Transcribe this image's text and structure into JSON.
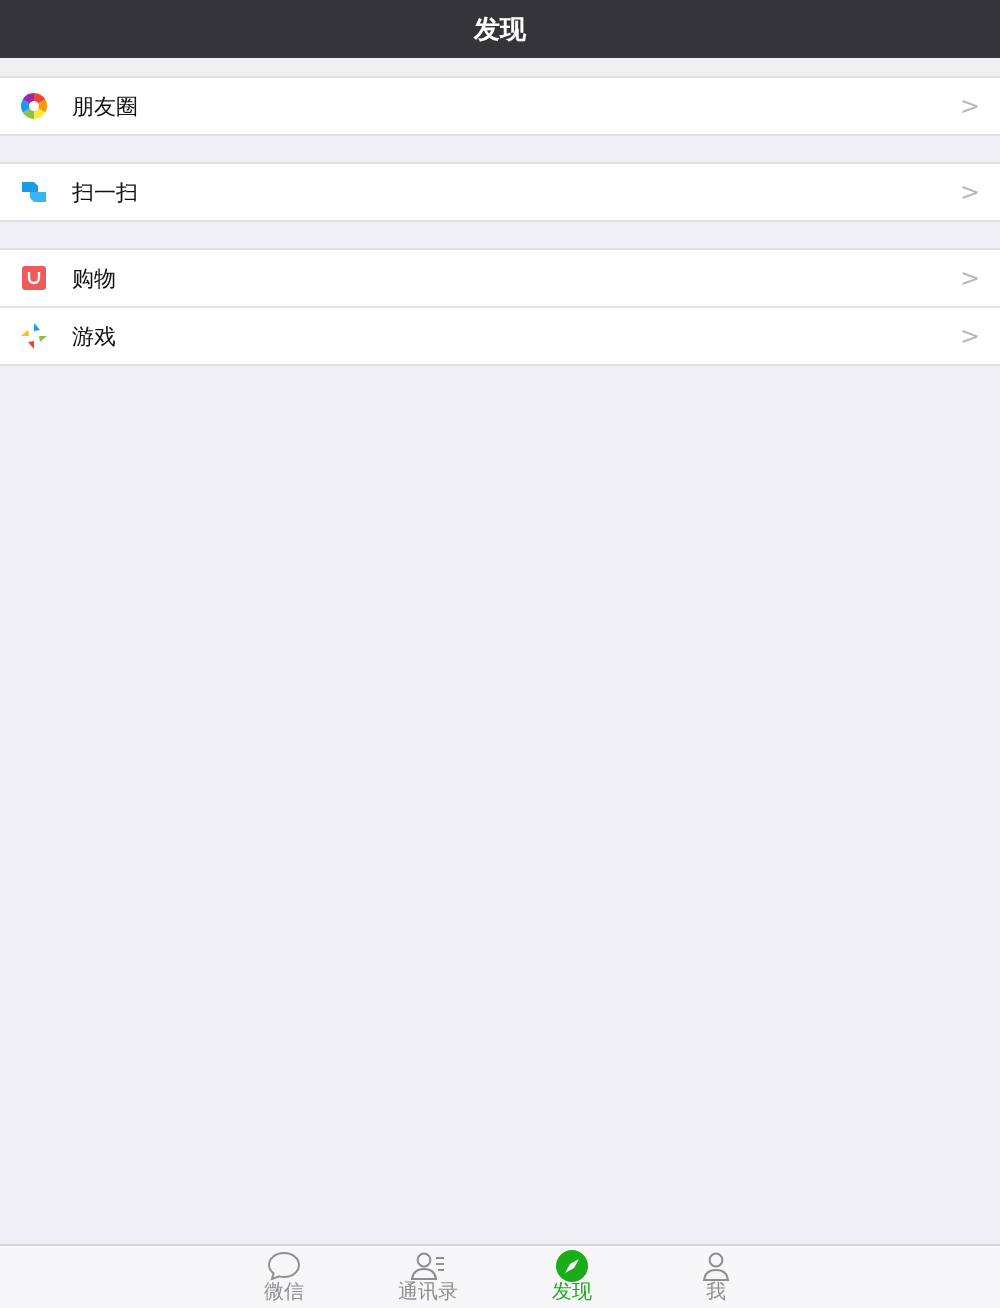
{
  "header": {
    "title": "发现"
  },
  "groups": [
    {
      "items": [
        {
          "kind": "moments",
          "label": "朋友圈",
          "chevron": ">"
        }
      ]
    },
    {
      "items": [
        {
          "kind": "scan",
          "label": "扫一扫",
          "chevron": ">"
        }
      ]
    },
    {
      "items": [
        {
          "kind": "shop",
          "label": "购物",
          "chevron": ">"
        },
        {
          "kind": "games",
          "label": "游戏",
          "chevron": ">"
        }
      ]
    }
  ],
  "tabs": [
    {
      "kind": "chats",
      "label": "微信",
      "selected": false
    },
    {
      "kind": "contacts",
      "label": "通讯录",
      "selected": false
    },
    {
      "kind": "discover",
      "label": "发现",
      "selected": true
    },
    {
      "kind": "me",
      "label": "我",
      "selected": false
    }
  ]
}
